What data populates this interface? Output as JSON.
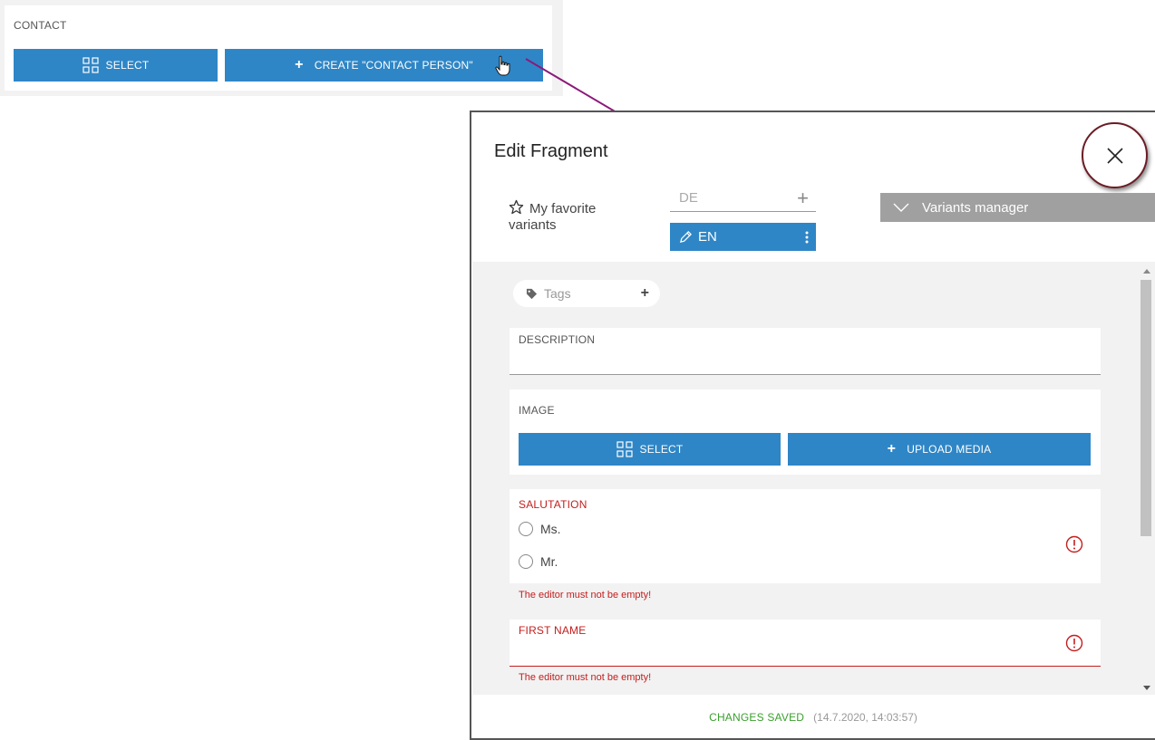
{
  "contact": {
    "label": "CONTACT",
    "select_label": "SELECT",
    "create_label": "CREATE \"CONTACT PERSON\""
  },
  "dialog": {
    "title": "Edit Fragment",
    "favorites_label": "My favorite variants",
    "languages": [
      {
        "code": "DE",
        "active": false
      },
      {
        "code": "EN",
        "active": true
      }
    ],
    "variants_manager_label": "Variants manager",
    "tags_placeholder": "Tags",
    "fields": {
      "description": {
        "label": "DESCRIPTION",
        "value": ""
      },
      "image": {
        "label": "IMAGE",
        "select_label": "SELECT",
        "upload_label": "UPLOAD MEDIA"
      },
      "salutation": {
        "label": "SALUTATION",
        "options": [
          "Ms.",
          "Mr."
        ],
        "error": "The editor must not be empty!"
      },
      "first_name": {
        "label": "FIRST NAME",
        "value": "",
        "error": "The editor must not be empty!"
      }
    },
    "footer": {
      "status": "CHANGES SAVED",
      "timestamp": "(14.7.2020, 14:03:57)"
    }
  },
  "colors": {
    "primary": "#2f86c6",
    "error": "#c41e1e",
    "success": "#3aa02d",
    "annotation": "#8b1a7a",
    "variants_bar": "#a0a0a0"
  }
}
